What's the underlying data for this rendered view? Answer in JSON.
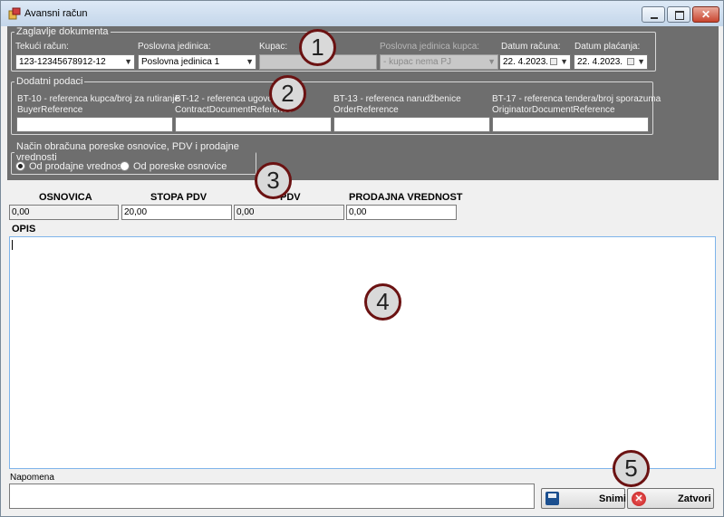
{
  "window": {
    "title": "Avansni račun",
    "close_glyph": "✕"
  },
  "header": {
    "legend": "Zaglavlje dokumenta",
    "tekuci_racun_label": "Tekući račun:",
    "tekuci_racun_value": "123-12345678912-12",
    "poslovna_jedinica_label": "Poslovna jedinica:",
    "poslovna_jedinica_value": "Poslovna jedinica 1",
    "kupac_label": "Kupac:",
    "kupac_value": "",
    "pj_kupca_label": "Poslovna jedinica kupca:",
    "pj_kupca_value": "- kupac nema PJ",
    "datum_racuna_label": "Datum računa:",
    "datum_racuna_value": "22.  4.2023.",
    "datum_placanja_label": "Datum plaćanja:",
    "datum_placanja_value": "22.  4.2023."
  },
  "dodatni": {
    "legend": "Dodatni podaci",
    "bt10_line1": "BT-10 - referenca kupca/broj za rutiranje",
    "bt10_line2": "BuyerReference",
    "bt12_line1": "BT-12 - referenca ugovora",
    "bt12_line2": "ContractDocumentReference",
    "bt13_line1": "BT-13 - referenca narudžbenice",
    "bt13_line2": "OrderReference",
    "bt17_line1": "BT-17 - referenca tendera/broj sporazuma",
    "bt17_line2": "OriginatorDocumentReference"
  },
  "nacin": {
    "legend": "Način obračuna poreske osnovice, PDV i prodajne vrednosti",
    "option1": "Od prodajne vrednosti",
    "option2": "Od poreske osnovice",
    "selected": "option1"
  },
  "amounts": {
    "osnovica_label": "OSNOVICA",
    "osnovica_value": "0,00",
    "stopa_label": "STOPA PDV",
    "stopa_value": "20,00",
    "pdv_label": "PDV",
    "pdv_value": "0,00",
    "prodajna_label": "PRODAJNA VREDNOST",
    "prodajna_value": "0,00"
  },
  "opis_label": "OPIS",
  "napomena_label": "Napomena",
  "buttons": {
    "snimi": "Snimi",
    "zatvori": "Zatvori"
  },
  "badges": [
    "1",
    "2",
    "3",
    "4",
    "5"
  ],
  "icons": {
    "dropdown": "▼",
    "close": "✕"
  }
}
